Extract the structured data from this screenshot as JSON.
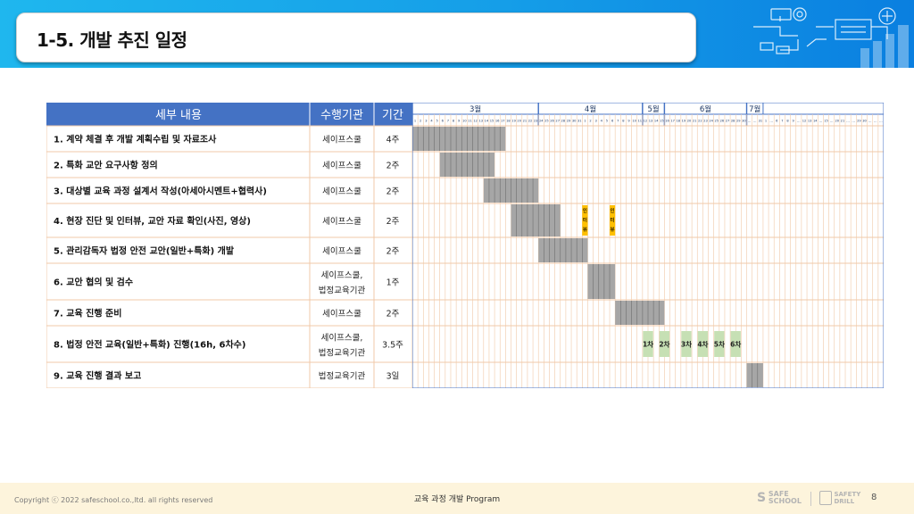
{
  "slide": {
    "title": "1-5. 개발 추진 일정",
    "footer_copyright": "Copyright ⓒ 2022 safeschool.co.,ltd. all rights reserved",
    "footer_center": "교육 과정 개발 Program",
    "logo_safe_school": [
      "SAFE",
      "SCHOOL"
    ],
    "logo_safety_drill": [
      "SAFETY",
      "DRILL"
    ],
    "page_number": "8"
  },
  "colors": {
    "banner": "#159ee8",
    "header_bg": "#4472c4",
    "row_border": "#f0c9a8",
    "gantt_bar": "#a6a6a6",
    "interview": "#ffc000",
    "session": "#c6e0b4",
    "footer_bg": "#fdf4dc"
  },
  "table": {
    "headers": [
      "세부 내용",
      "수행기관",
      "기간"
    ],
    "rows": [
      {
        "task": "1. 계약 체결 후 개발 계획수립 및 자료조사",
        "org": [
          "세이프스쿨"
        ],
        "duration": "4주"
      },
      {
        "task": "2. 특화 교안 요구사항 정의",
        "org": [
          "세이프스쿨"
        ],
        "duration": "2주"
      },
      {
        "task": "3. 대상별 교육 과정 설계서 작성(아세아시멘트+협력사)",
        "org": [
          "세이프스쿨"
        ],
        "duration": "2주"
      },
      {
        "task": "4. 현장 진단 및 인터뷰, 교안 자료 확인(사진, 영상)",
        "org": [
          "세이프스쿨"
        ],
        "duration": "2주"
      },
      {
        "task": "5. 관리감독자 법정 안전 교안(일반+특화) 개발",
        "org": [
          "세이프스쿨"
        ],
        "duration": "2주"
      },
      {
        "task": "6. 교안 협의 및 검수",
        "org": [
          "세이프스쿨,",
          "법정교육기관"
        ],
        "duration": "1주"
      },
      {
        "task": "7. 교육 진행 준비",
        "org": [
          "세이프스쿨"
        ],
        "duration": "2주"
      },
      {
        "task": "8. 법정 안전 교육(일반+특화) 진행(16h, 6차수)",
        "org": [
          "세이프스쿨,",
          "법정교육기관"
        ],
        "duration": "3.5주"
      },
      {
        "task": "9. 교육 진행 결과 보고",
        "org": [
          "법정교육기관"
        ],
        "duration": "3일"
      }
    ]
  },
  "gantt": {
    "months": [
      {
        "label": "3월",
        "start": 0,
        "end": 23
      },
      {
        "label": "4월",
        "start": 23,
        "end": 42
      },
      {
        "label": "5월",
        "start": 42,
        "end": 46
      },
      {
        "label": "6월",
        "start": 46,
        "end": 61
      },
      {
        "label": "7월",
        "start": 61,
        "end": 64
      }
    ],
    "day_labels": [
      "1",
      "2",
      "3",
      "4",
      "5",
      "6",
      "7",
      "8",
      "9",
      "10",
      "11",
      "12",
      "13",
      "14",
      "15",
      "16",
      "17",
      "18",
      "19",
      "20",
      "21",
      "22",
      "23",
      "24",
      "25",
      "26",
      "27",
      "28",
      "29",
      "30",
      "31",
      "1",
      "2",
      "3",
      "4",
      "5",
      "6",
      "7",
      "8",
      "9",
      "10",
      "11",
      "12",
      "13",
      "14",
      "15",
      "16",
      "17",
      "18",
      "19",
      "20",
      "21",
      "22",
      "23",
      "24",
      "25",
      "26",
      "27",
      "28",
      "29",
      "30",
      "…",
      "…",
      "31",
      "1",
      "…",
      "6",
      "7",
      "8",
      "9",
      "…",
      "12",
      "13",
      "14",
      "…",
      "15",
      "…",
      "20",
      "21",
      "…",
      "…",
      "29",
      "30",
      "…",
      "…",
      "…"
    ],
    "bars": [
      {
        "row": 0,
        "start": 0,
        "end": 17
      },
      {
        "row": 1,
        "start": 5,
        "end": 15
      },
      {
        "row": 2,
        "start": 13,
        "end": 23
      },
      {
        "row": 3,
        "start": 18,
        "end": 27
      },
      {
        "row": 4,
        "start": 23,
        "end": 32
      },
      {
        "row": 5,
        "start": 32,
        "end": 37
      },
      {
        "row": 6,
        "start": 37,
        "end": 46
      },
      {
        "row": 8,
        "start": 61,
        "end": 64
      }
    ],
    "interviews": [
      {
        "row": 3,
        "col": 31,
        "label": [
          "인",
          "터",
          "뷰"
        ]
      },
      {
        "row": 3,
        "col": 36,
        "label": [
          "인",
          "터",
          "뷰"
        ]
      }
    ],
    "sessions": [
      {
        "row": 7,
        "col": 42,
        "label": "1차"
      },
      {
        "row": 7,
        "col": 45,
        "label": "2차"
      },
      {
        "row": 7,
        "col": 49,
        "label": "3차"
      },
      {
        "row": 7,
        "col": 52,
        "label": "4차"
      },
      {
        "row": 7,
        "col": 55,
        "label": "5차"
      },
      {
        "row": 7,
        "col": 58,
        "label": "6차"
      }
    ]
  }
}
